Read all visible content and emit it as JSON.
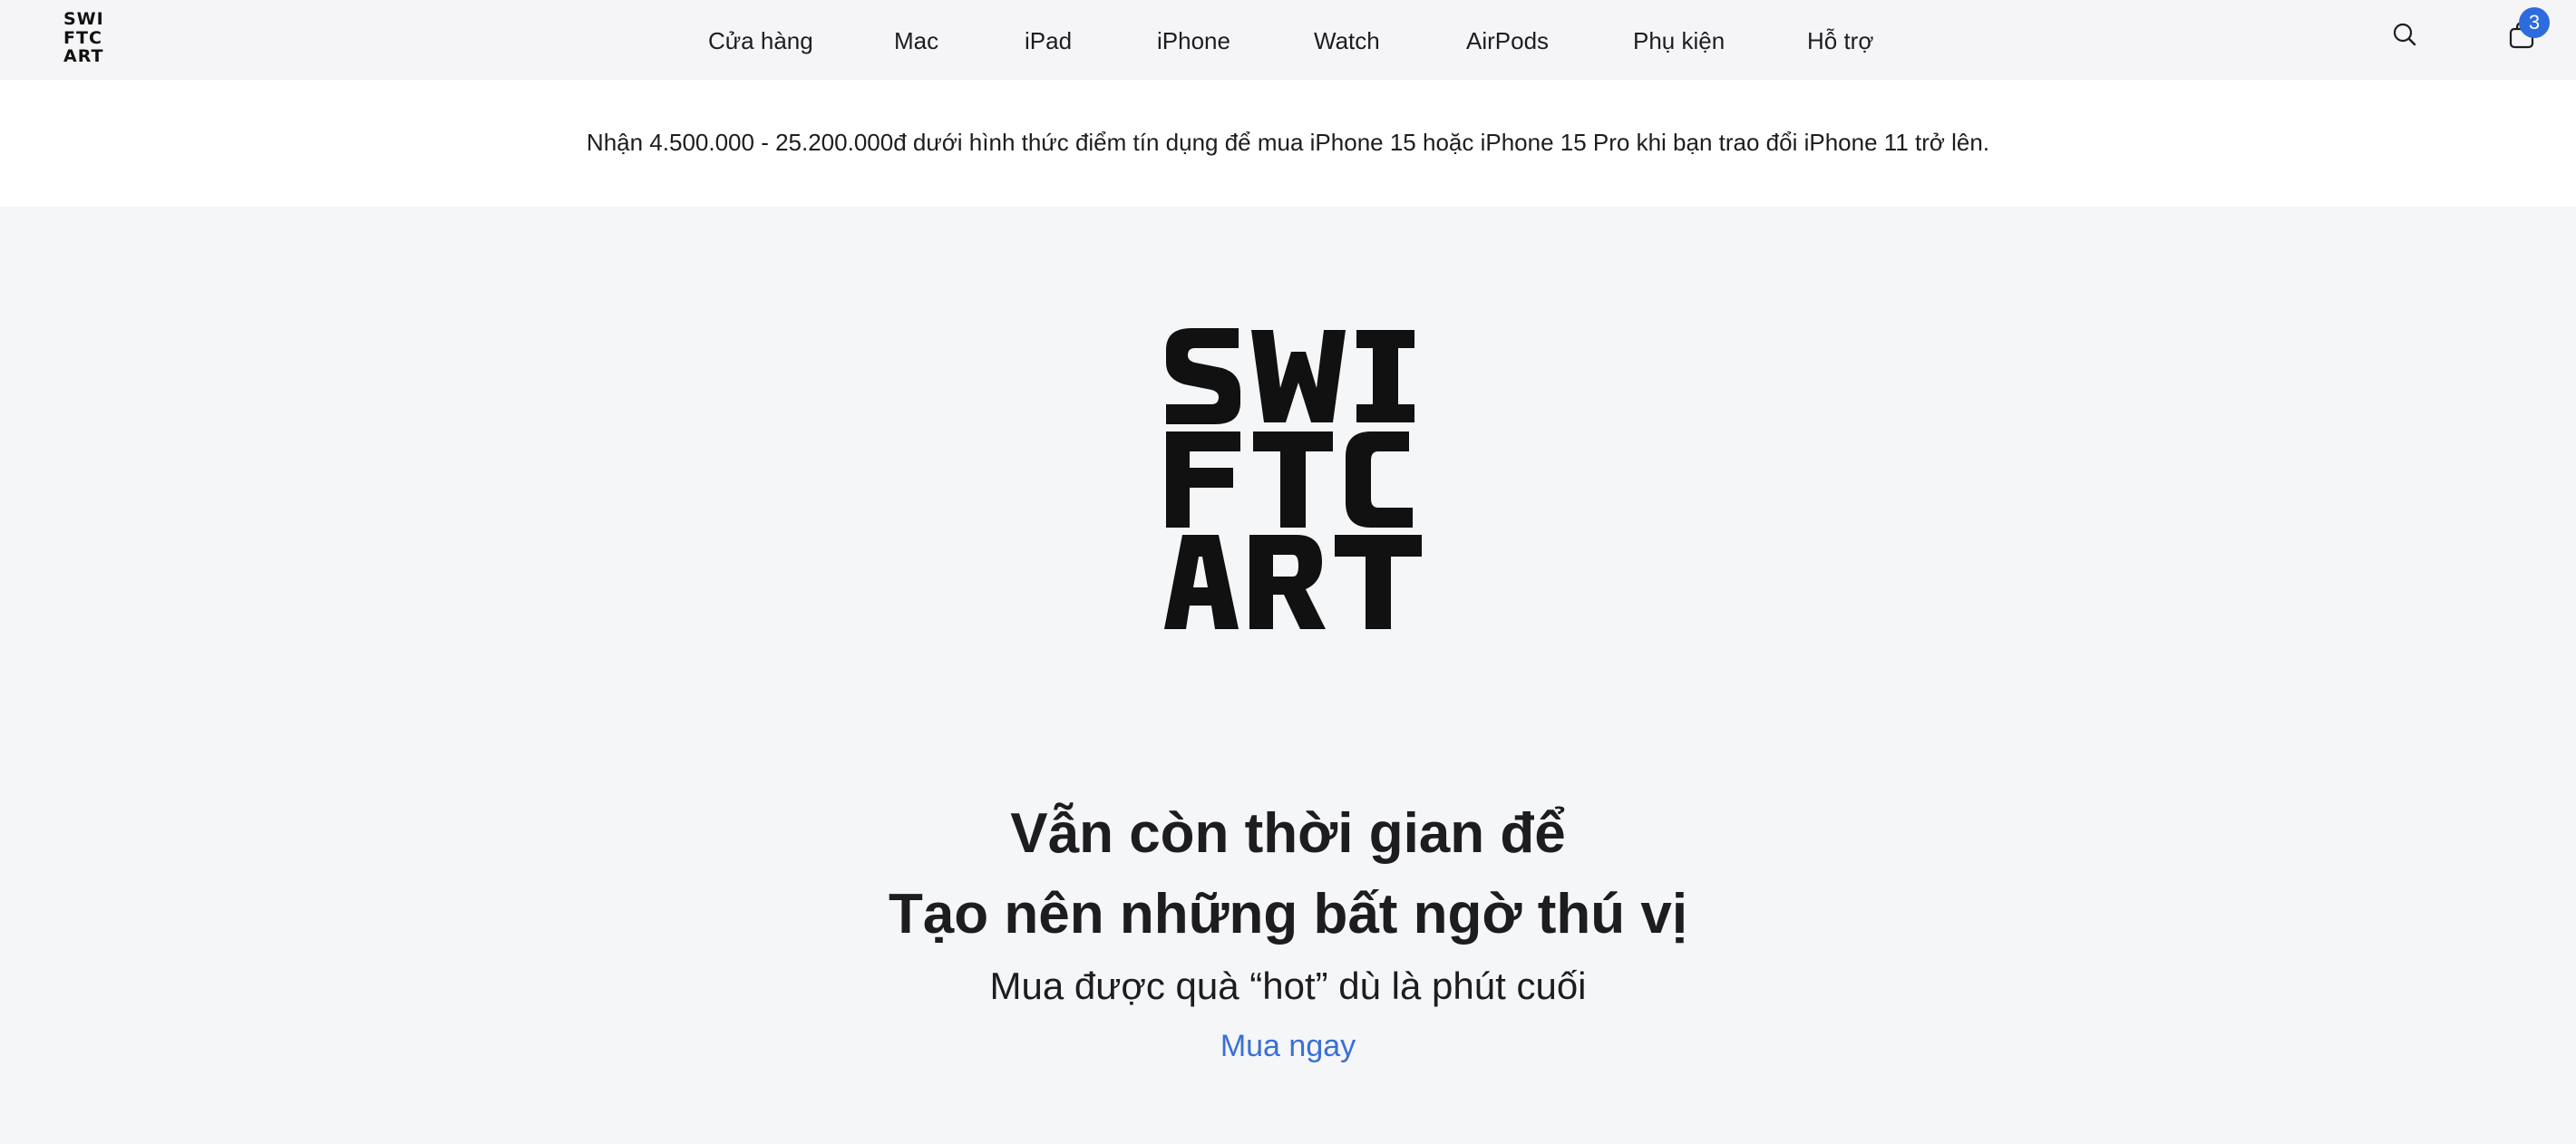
{
  "brand": {
    "logo_rows": [
      "SWI",
      "FTC",
      "ART"
    ]
  },
  "nav": {
    "items": [
      {
        "label": "Cửa hàng"
      },
      {
        "label": "Mac"
      },
      {
        "label": "iPad"
      },
      {
        "label": "iPhone"
      },
      {
        "label": "Watch"
      },
      {
        "label": "AirPods"
      },
      {
        "label": "Phụ kiện"
      },
      {
        "label": "Hỗ trợ"
      }
    ],
    "search_icon": "search-icon",
    "cart_icon": "shopping-bag-icon",
    "cart_count": "3"
  },
  "promo": {
    "text": "Nhận 4.500.000 - 25.200.000đ dưới hình thức điểm tín dụng để mua iPhone 15 hoặc iPhone 15 Pro khi bạn trao đổi iPhone 11 trở lên."
  },
  "hero": {
    "title_line1": "Vẫn còn thời gian để",
    "title_line2": "Tạo nên những bất ngờ thú vị",
    "subtitle": "Mua được quà “hot” dù là phút cuối",
    "cta": "Mua ngay"
  },
  "colors": {
    "accent_link": "#3b6fd6",
    "badge": "#2c6cde",
    "text": "#1d1d1f",
    "nav_bg": "#f5f5f7",
    "hero_bg": "#f5f6f8"
  }
}
